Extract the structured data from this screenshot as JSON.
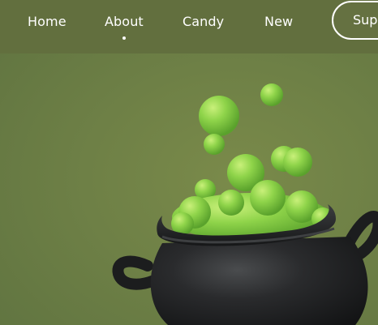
{
  "nav": {
    "items": [
      {
        "label": "Home"
      },
      {
        "label": "About",
        "active": true
      },
      {
        "label": "Candy"
      },
      {
        "label": "New"
      }
    ],
    "cta_label": "Sup"
  },
  "colors": {
    "background": "#6e8046",
    "topbar": "#626f3e",
    "slime": "#8fd44a",
    "cauldron": "#1f2021"
  },
  "hero": {
    "image": "cauldron-with-green-bubbles"
  }
}
